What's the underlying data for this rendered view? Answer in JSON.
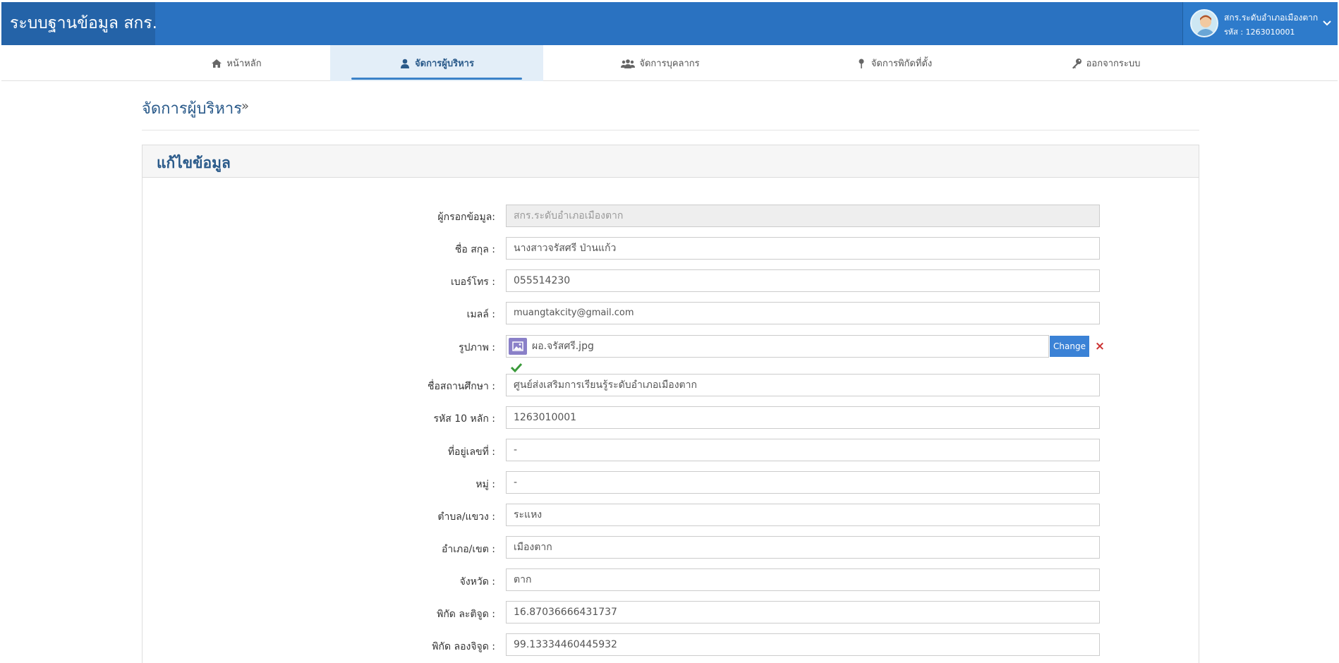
{
  "header": {
    "brand": "ระบบฐานข้อมูล สกร.",
    "user_name": "สกร.ระดับอำเภอเมืองตาก",
    "user_code": "รหัส : 1263010001"
  },
  "nav": [
    {
      "label": "หน้าหลัก",
      "icon": "home-icon"
    },
    {
      "label": "จัดการผู้บริหาร",
      "icon": "user-icon"
    },
    {
      "label": "จัดการบุคลากร",
      "icon": "users-icon"
    },
    {
      "label": "จัดการพิกัดที่ตั้ง",
      "icon": "pin-icon"
    },
    {
      "label": "ออกจากระบบ",
      "icon": "key-icon"
    }
  ],
  "breadcrumb": {
    "current": "จัดการผู้บริหาร",
    "separator": "»"
  },
  "panel": {
    "title": "แก้ไขข้อมูล"
  },
  "form": {
    "filler": {
      "label": "ผู้กรอกข้อมูล:",
      "value": "สกร.ระดับอำเภอเมืองตาก"
    },
    "fullname": {
      "label": "ชื่อ สกุล :",
      "value": "นางสาวจรัสศรี ป่านแก้ว"
    },
    "phone": {
      "label": "เบอร์โทร :",
      "value": "055514230"
    },
    "email": {
      "label": "เมลล์ :",
      "value": "muangtakcity@gmail.com"
    },
    "photo": {
      "label": "รูปภาพ :",
      "filename": "ผอ.จรัสศรี.jpg",
      "change_label": "Change",
      "remove_label": "×"
    },
    "school": {
      "label": "ชื่อสถานศึกษา :",
      "value": "ศูนย์ส่งเสริมการเรียนรู้ระดับอำเภอเมืองตาก"
    },
    "code10": {
      "label": "รหัส 10 หลัก :",
      "value": "1263010001"
    },
    "house_no": {
      "label": "ที่อยู่เลขที่ :",
      "value": "-"
    },
    "moo": {
      "label": "หมู่ :",
      "value": "-"
    },
    "tambon": {
      "label": "ตำบล/แขวง :",
      "value": "ระแหง"
    },
    "amphoe": {
      "label": "อำเภอ/เขต :",
      "value": "เมืองตาก"
    },
    "province": {
      "label": "จังหวัด :",
      "value": "ตาก"
    },
    "lat": {
      "label": "พิกัด ละติจูด :",
      "value": "16.87036666431737"
    },
    "lng": {
      "label": "พิกัด ลองจิจูด :",
      "value": "99.13334460445932"
    }
  },
  "colors": {
    "header": "#2a72c1",
    "brand_bg": "#2463a8",
    "accent": "#3b82d6",
    "title": "#2a5a8a"
  }
}
